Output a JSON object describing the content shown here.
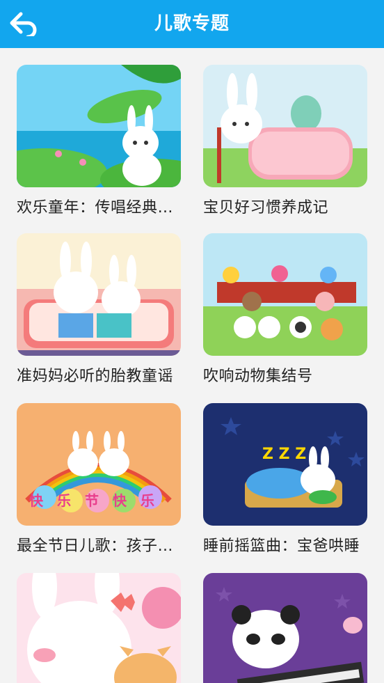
{
  "header": {
    "title": "儿歌专题"
  },
  "cards": [
    {
      "label": "欢乐童年：传唱经典儿歌"
    },
    {
      "label": "宝贝好习惯养成记"
    },
    {
      "label": "准妈妈必听的胎教童谣"
    },
    {
      "label": "吹响动物集结号"
    },
    {
      "label": "最全节日儿歌：孩子们的快乐"
    },
    {
      "label": "睡前摇篮曲：宝爸哄睡"
    },
    {
      "label": ""
    },
    {
      "label": ""
    }
  ],
  "colors": {
    "header": "#12a6ee",
    "background": "#f3f3f3"
  },
  "thumb_text": {
    "card4": "快乐节快乐",
    "card5": "Z Z Z"
  }
}
